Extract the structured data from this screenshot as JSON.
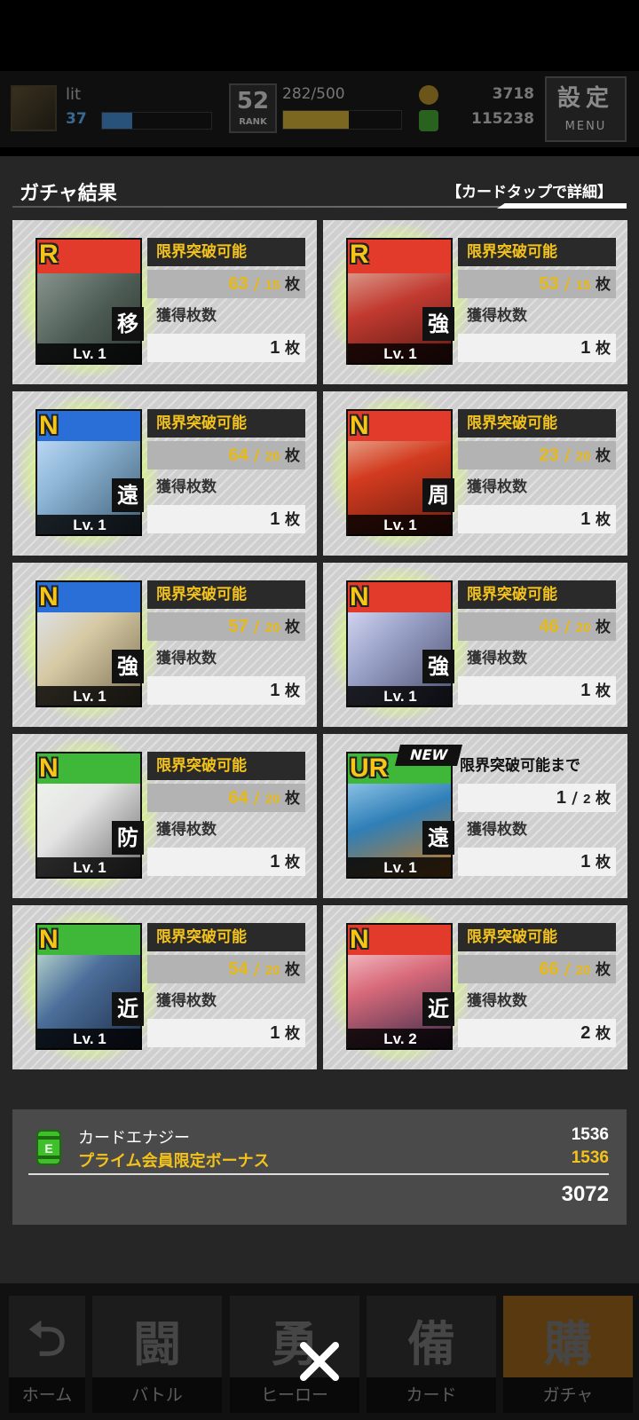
{
  "header": {
    "player_name": "lit",
    "player_level": "37",
    "player_xp_progress": 0.28,
    "rank": "52",
    "rank_label": "RANK",
    "stamina": "282/500",
    "stamina_progress": 0.56,
    "coins": "3718",
    "energy": "115238",
    "menu_top": "設定",
    "menu_bottom": "MENU"
  },
  "page": {
    "title": "ガチャ結果",
    "hint": "【カードタップで詳細】"
  },
  "cards": [
    {
      "rarity": "R",
      "type": "移",
      "level": "Lv. 1",
      "new": false,
      "lb_label": "限界突破可能",
      "lb_current": "63",
      "lb_max": "15",
      "got_label": "獲得枚数",
      "got": "1",
      "unit": "枚"
    },
    {
      "rarity": "R",
      "type": "強",
      "level": "Lv. 1",
      "new": false,
      "lb_label": "限界突破可能",
      "lb_current": "53",
      "lb_max": "15",
      "got_label": "獲得枚数",
      "got": "1",
      "unit": "枚"
    },
    {
      "rarity": "N",
      "type": "遠",
      "level": "Lv. 1",
      "new": false,
      "lb_label": "限界突破可能",
      "lb_current": "64",
      "lb_max": "20",
      "got_label": "獲得枚数",
      "got": "1",
      "unit": "枚"
    },
    {
      "rarity": "N",
      "type": "周",
      "level": "Lv. 1",
      "new": false,
      "lb_label": "限界突破可能",
      "lb_current": "23",
      "lb_max": "20",
      "got_label": "獲得枚数",
      "got": "1",
      "unit": "枚"
    },
    {
      "rarity": "N",
      "type": "強",
      "level": "Lv. 1",
      "new": false,
      "lb_label": "限界突破可能",
      "lb_current": "57",
      "lb_max": "20",
      "got_label": "獲得枚数",
      "got": "1",
      "unit": "枚"
    },
    {
      "rarity": "N",
      "type": "強",
      "level": "Lv. 1",
      "new": false,
      "lb_label": "限界突破可能",
      "lb_current": "46",
      "lb_max": "20",
      "got_label": "獲得枚数",
      "got": "1",
      "unit": "枚"
    },
    {
      "rarity": "N",
      "type": "防",
      "level": "Lv. 1",
      "new": false,
      "lb_label": "限界突破可能",
      "lb_current": "64",
      "lb_max": "20",
      "got_label": "獲得枚数",
      "got": "1",
      "unit": "枚"
    },
    {
      "rarity": "UR",
      "type": "遠",
      "level": "Lv. 1",
      "new": true,
      "new_label": "NEW",
      "lb_label": "限界突破可能まで",
      "lb_current": "1",
      "lb_max": "2",
      "got_label": "獲得枚数",
      "got": "1",
      "unit": "枚"
    },
    {
      "rarity": "N",
      "type": "近",
      "level": "Lv. 1",
      "new": false,
      "lb_label": "限界突破可能",
      "lb_current": "54",
      "lb_max": "20",
      "got_label": "獲得枚数",
      "got": "1",
      "unit": "枚"
    },
    {
      "rarity": "N",
      "type": "近",
      "level": "Lv. 2",
      "new": false,
      "lb_label": "限界突破可能",
      "lb_current": "66",
      "lb_max": "20",
      "got_label": "獲得枚数",
      "got": "2",
      "unit": "枚"
    }
  ],
  "energy_summary": {
    "label": "カードエナジー",
    "value": "1536",
    "bonus_label": "プライム会員限定ボーナス",
    "bonus_value": "1536",
    "total": "3072"
  },
  "nav": [
    {
      "label": "ホーム",
      "icon": "home-icon",
      "glyph": "⮌"
    },
    {
      "label": "バトル",
      "icon": "battle-icon",
      "glyph": "闘"
    },
    {
      "label": "ヒーロー",
      "icon": "hero-icon",
      "glyph": "勇"
    },
    {
      "label": "カード",
      "icon": "card-icon",
      "glyph": "備"
    },
    {
      "label": "ガチャ",
      "icon": "gacha-icon",
      "glyph": "購"
    }
  ],
  "colors": {
    "accent_gold": "#f3c21b",
    "rarity_r": "#e23b2b",
    "rarity_n_blue": "#2a6fd8",
    "rarity_ur": "#3fb83a"
  }
}
